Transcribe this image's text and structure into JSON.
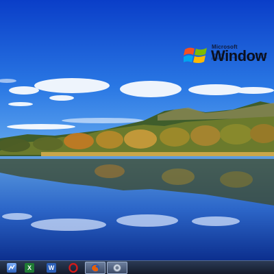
{
  "desktop": {
    "logo": {
      "company": "Microsoft",
      "product": "Window",
      "colors": {
        "red": "#f25022",
        "green": "#7fba00",
        "blue": "#00a4ef",
        "yellow": "#ffb900"
      }
    }
  },
  "taskbar": {
    "items": [
      {
        "icon": "app-icon",
        "color": "#3a7bd5"
      },
      {
        "icon": "excel-icon",
        "color": "#1e7b34",
        "glyph": "X"
      },
      {
        "icon": "word-icon",
        "color": "#2b5fb8",
        "glyph": "W"
      },
      {
        "icon": "opera-icon",
        "color": "#d11a1a",
        "glyph": "O"
      },
      {
        "icon": "firefox-icon",
        "color": "#e6600a"
      },
      {
        "icon": "settings-icon",
        "color": "#9aa6b8"
      }
    ]
  }
}
